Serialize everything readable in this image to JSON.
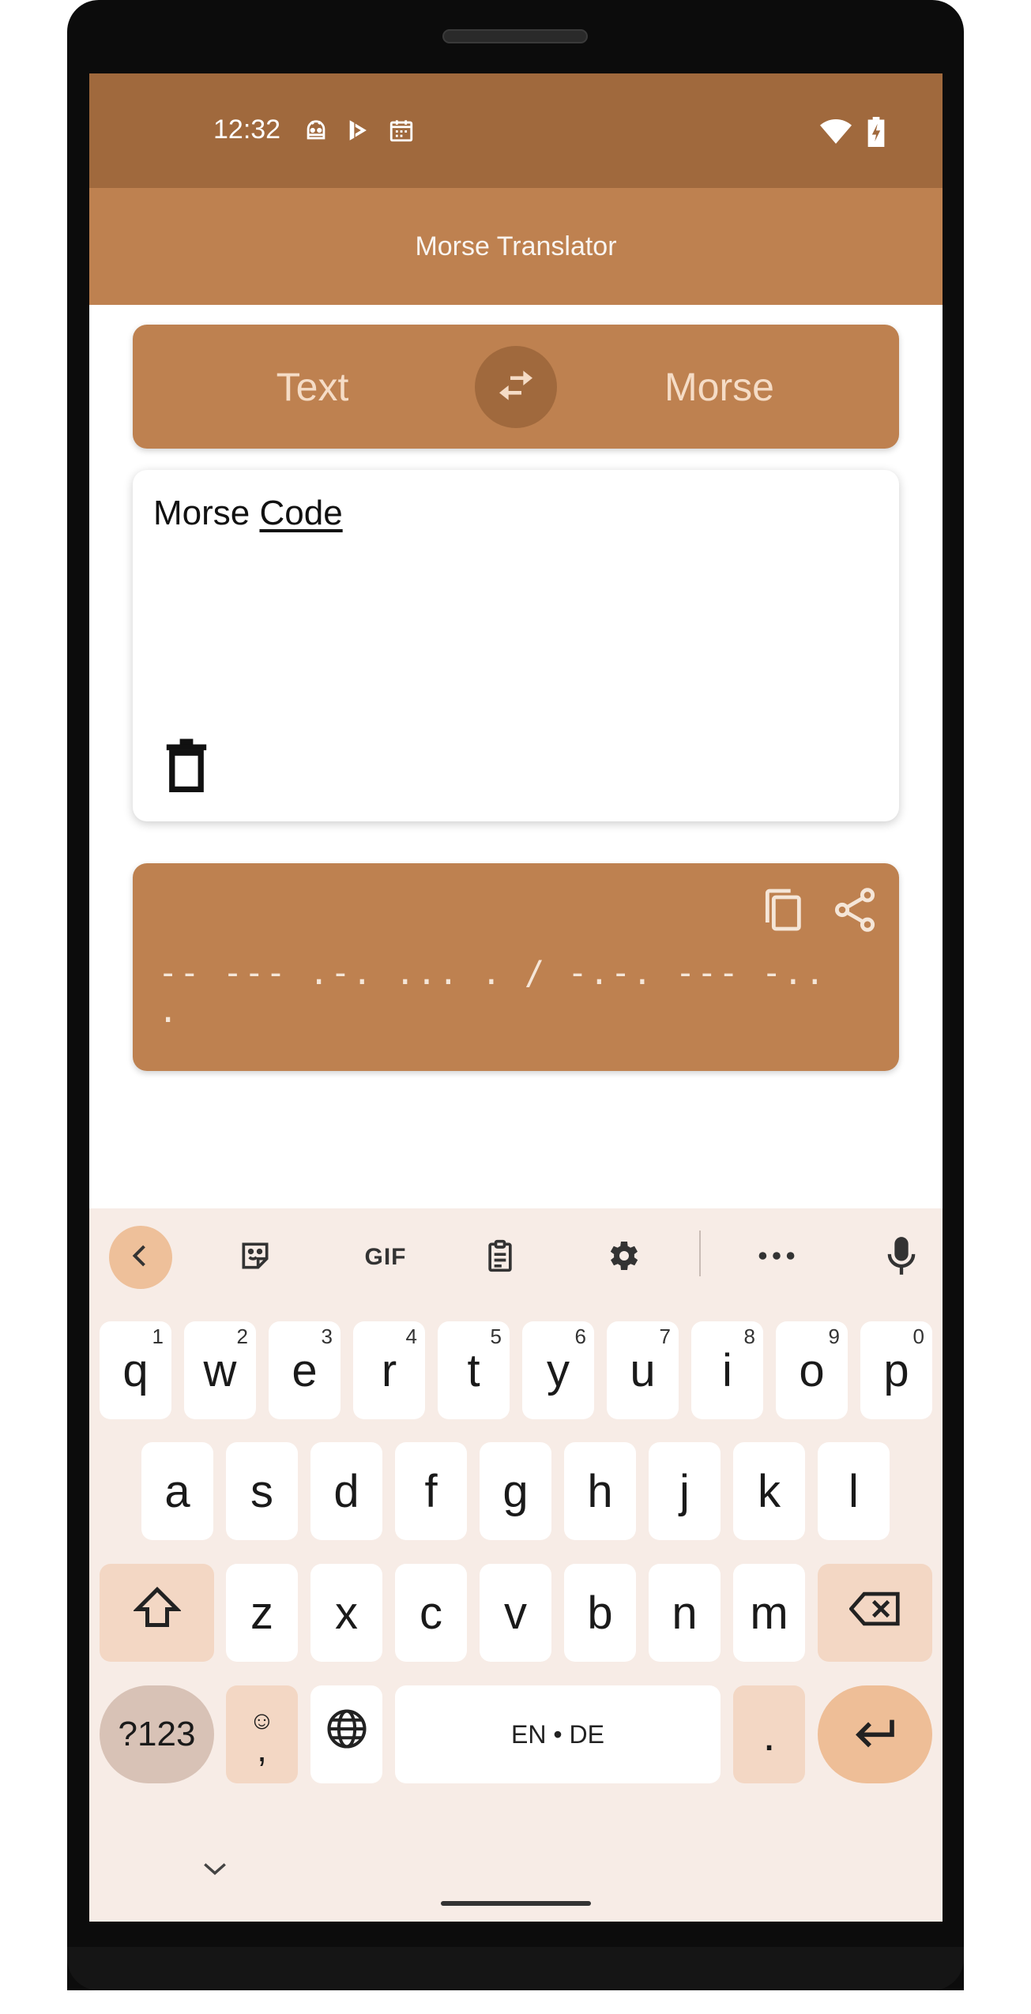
{
  "status_bar": {
    "time": "12:32",
    "left_icons": [
      "robot-icon",
      "play-store-icon",
      "calendar-icon"
    ],
    "right_icons": [
      "wifi-icon",
      "battery-charging-icon"
    ]
  },
  "app_bar": {
    "title": "Morse Translator"
  },
  "swap": {
    "left_label": "Text",
    "right_label": "Morse",
    "swap_icon": "swap-icon"
  },
  "input": {
    "text_plain": "Morse ",
    "text_underlined": "Code",
    "clear_icon": "trash-icon"
  },
  "output": {
    "morse_text": "-- --- .-. ... . / -.-. --- -.. .",
    "copy_icon": "copy-icon",
    "share_icon": "share-icon"
  },
  "keyboard": {
    "toolbar": [
      "chevron-left-icon",
      "sticker-icon",
      "GIF",
      "clipboard-icon",
      "gear-icon",
      "more-icon",
      "mic-icon"
    ],
    "row1": [
      {
        "key": "q",
        "sup": "1"
      },
      {
        "key": "w",
        "sup": "2"
      },
      {
        "key": "e",
        "sup": "3"
      },
      {
        "key": "r",
        "sup": "4"
      },
      {
        "key": "t",
        "sup": "5"
      },
      {
        "key": "y",
        "sup": "6"
      },
      {
        "key": "u",
        "sup": "7"
      },
      {
        "key": "i",
        "sup": "8"
      },
      {
        "key": "o",
        "sup": "9"
      },
      {
        "key": "p",
        "sup": "0"
      }
    ],
    "row2": [
      "a",
      "s",
      "d",
      "f",
      "g",
      "h",
      "j",
      "k",
      "l"
    ],
    "row3": [
      "z",
      "x",
      "c",
      "v",
      "b",
      "n",
      "m"
    ],
    "sym_label": "?123",
    "emoji_top": "☺",
    "emoji_bottom": ",",
    "space_label": "EN • DE",
    "period_label": ".",
    "colors": {
      "accent": "#BE8150",
      "accent_dark": "#A0693D",
      "kb_background": "#F7ECE6",
      "key_mod": "#F3D7C4",
      "key_enter": "#EEBE97"
    }
  }
}
